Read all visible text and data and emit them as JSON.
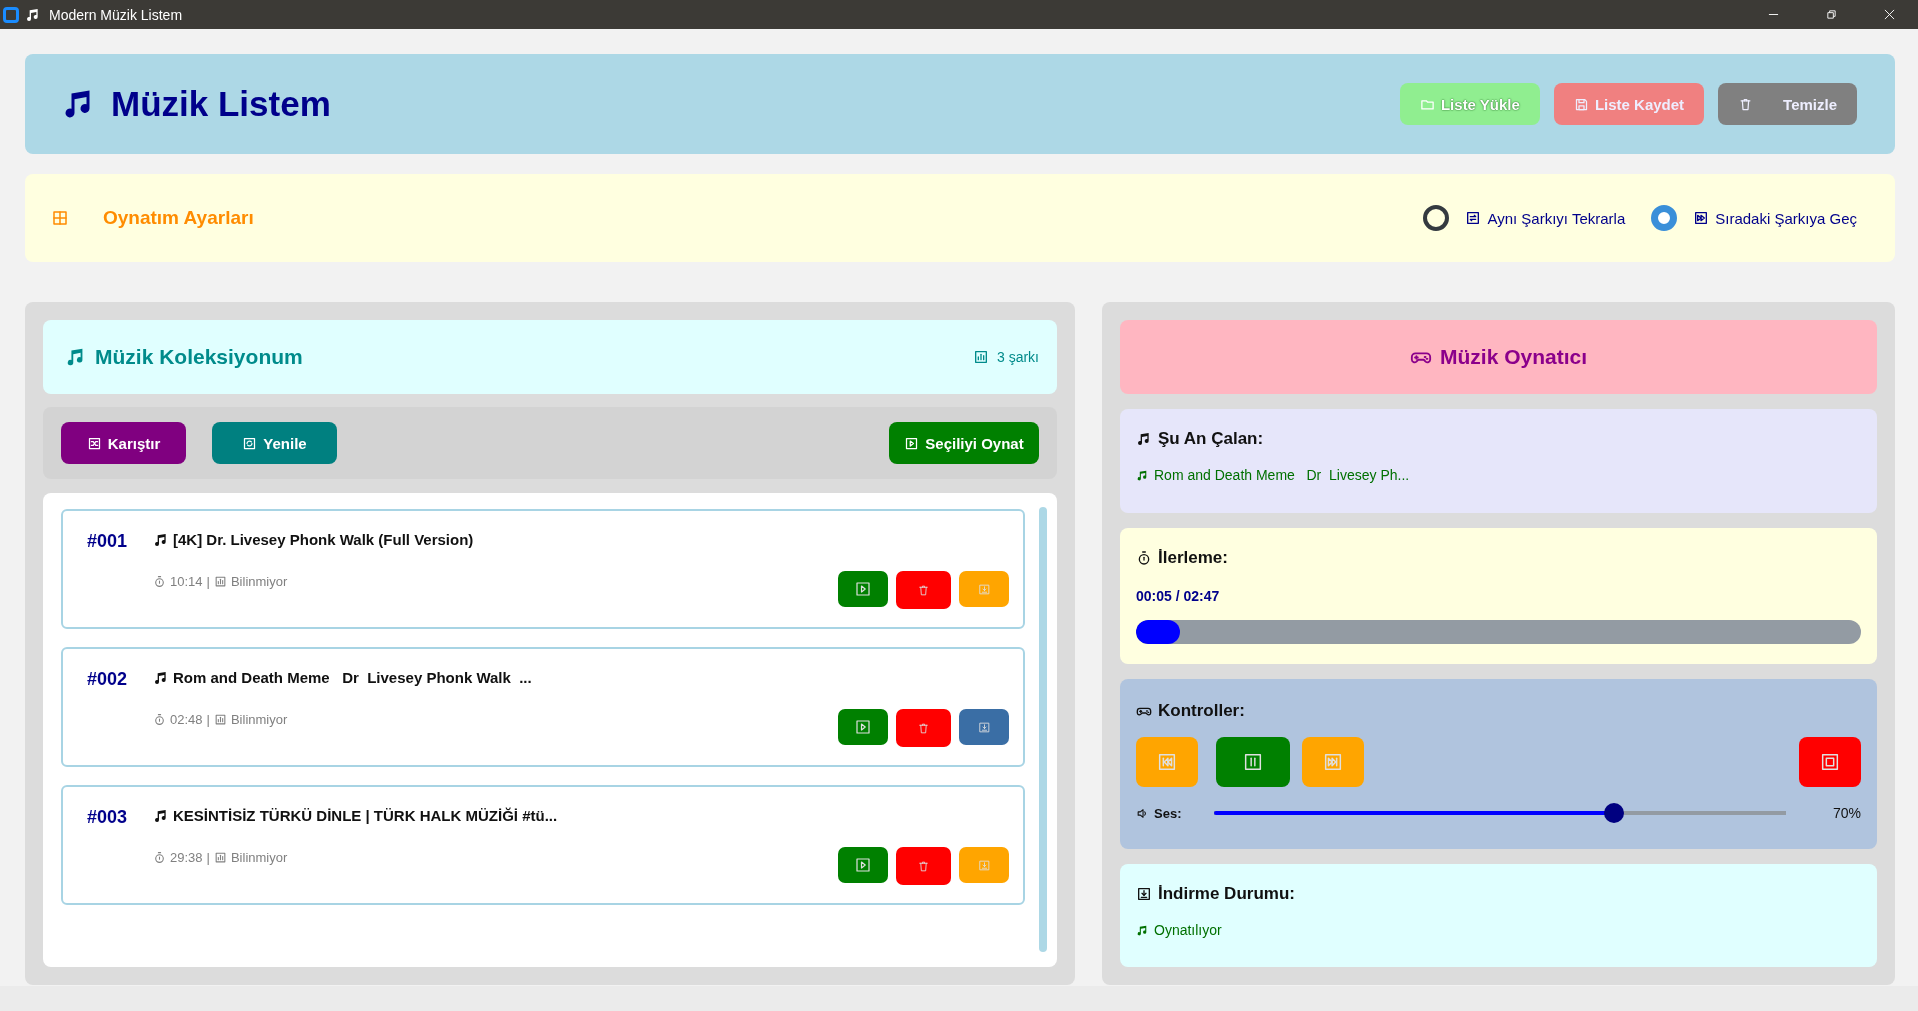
{
  "window": {
    "title": "Modern Müzik Listem"
  },
  "header": {
    "title": "Müzik Listem",
    "buttons": [
      {
        "label": "Liste Yükle",
        "kind": "load"
      },
      {
        "label": "Liste Kaydet",
        "kind": "save"
      },
      {
        "label": "Temizle",
        "kind": "clear"
      }
    ]
  },
  "settings": {
    "title": "Oynatım Ayarları",
    "options": [
      {
        "label": "Aynı Şarkıyı Tekrarla",
        "kind": "repeat",
        "selected": false
      },
      {
        "label": "Sıradaki Şarkıya Geç",
        "kind": "next",
        "selected": true
      }
    ]
  },
  "collection": {
    "title": "Müzik Koleksiyonum",
    "count": "3 şarkı",
    "toolbar": [
      {
        "label": "Karıştır",
        "kind": "shuffle"
      },
      {
        "label": "Yenile",
        "kind": "refresh"
      },
      {
        "label": "Seçiliyi Oynat",
        "kind": "play"
      }
    ],
    "songs": [
      {
        "number": "#001",
        "title": "[4K] Dr. Livesey Phonk Walk (Full Version)",
        "duration": "10:14",
        "separator": "|",
        "quality": "Bilinmiyor",
        "downloaded": false
      },
      {
        "number": "#002",
        "title": "Rom and Death Meme   Dr  Livesey Phonk Walk  ...",
        "duration": "02:48",
        "separator": "|",
        "quality": "Bilinmiyor",
        "downloaded": true
      },
      {
        "number": "#003",
        "title": "KESİNTİSİZ TÜRKÜ DİNLE | TÜRK HALK MÜZİĞİ #tü...",
        "duration": "29:38",
        "separator": "|",
        "quality": "Bilinmiyor",
        "downloaded": false
      }
    ]
  },
  "player": {
    "title": "Müzik Oynatıcı",
    "now_playing": {
      "label": "Şu An Çalan:",
      "track": "Rom and Death Meme   Dr  Livesey Ph..."
    },
    "progress": {
      "label": "İlerleme:",
      "time": "00:05 / 02:47",
      "level": 0.06
    },
    "controls": {
      "label": "Kontroller:",
      "buttons": [
        {
          "kind": "previous"
        },
        {
          "kind": "pause"
        },
        {
          "kind": "next"
        },
        {
          "kind": "stop"
        }
      ],
      "volume": {
        "label": "Ses:",
        "level": 0.7,
        "reading": "70%"
      }
    },
    "download": {
      "label": "İndirme Durumu:",
      "status": "Oynatılıyor"
    }
  }
}
